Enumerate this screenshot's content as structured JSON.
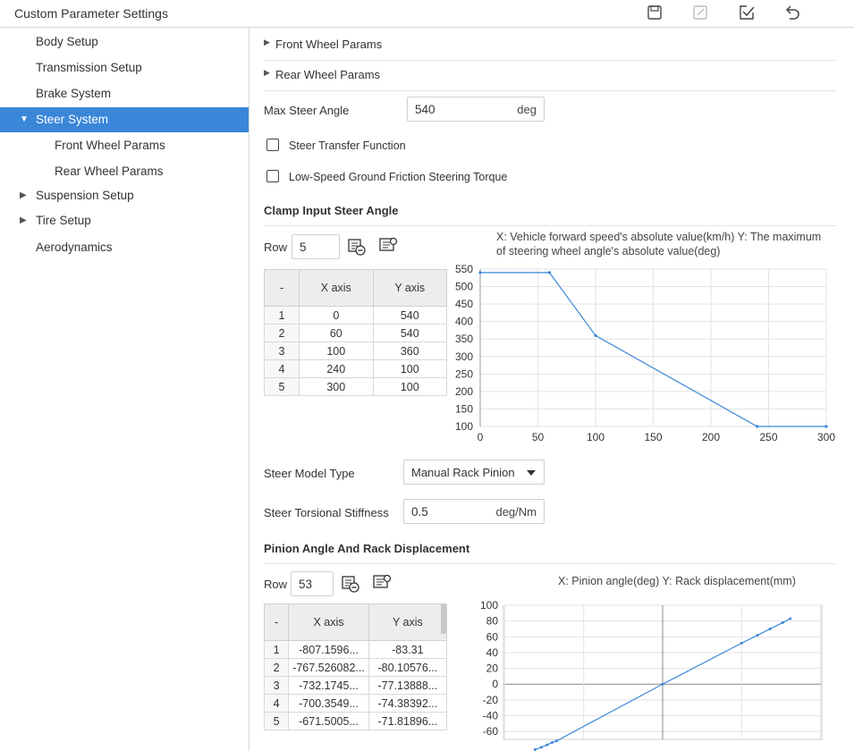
{
  "window": {
    "title": "Custom Parameter Settings",
    "toolbar": [
      {
        "name": "save-icon"
      },
      {
        "name": "edit-icon"
      },
      {
        "name": "confirm-icon"
      },
      {
        "name": "undo-icon"
      }
    ]
  },
  "sidebar": {
    "items": [
      {
        "label": "Body Setup",
        "level": 0,
        "arrow": "",
        "active": false
      },
      {
        "label": "Transmission Setup",
        "level": 0,
        "arrow": "",
        "active": false
      },
      {
        "label": "Brake System",
        "level": 0,
        "arrow": "",
        "active": false
      },
      {
        "label": "Steer System",
        "level": 0,
        "arrow": "▼",
        "active": true
      },
      {
        "label": "Front Wheel Params",
        "level": 1,
        "arrow": "",
        "active": false
      },
      {
        "label": "Rear Wheel Params",
        "level": 1,
        "arrow": "",
        "active": false
      },
      {
        "label": "Suspension Setup",
        "level": 0,
        "arrow": "▶",
        "active": false
      },
      {
        "label": "Tire Setup",
        "level": 0,
        "arrow": "▶",
        "active": false
      },
      {
        "label": "Aerodynamics",
        "level": 0,
        "arrow": "",
        "active": false
      }
    ]
  },
  "main": {
    "front_wheel_params": "Front Wheel Params",
    "rear_wheel_params": "Rear Wheel Params",
    "max_steer_angle": {
      "label": "Max Steer Angle",
      "value": "540",
      "unit": "deg"
    },
    "steer_transfer_function": {
      "label": "Steer Transfer Function",
      "checked": false
    },
    "low_speed_torque": {
      "label": "Low-Speed Ground Friction Steering Torque",
      "checked": false
    },
    "clamp": {
      "title": "Clamp Input Steer Angle",
      "row_label": "Row",
      "row_value": "5",
      "table": {
        "headers": [
          "-",
          "X axis",
          "Y axis"
        ],
        "rows": [
          [
            "1",
            "0",
            "540"
          ],
          [
            "2",
            "60",
            "540"
          ],
          [
            "3",
            "100",
            "360"
          ],
          [
            "4",
            "240",
            "100"
          ],
          [
            "5",
            "300",
            "100"
          ]
        ]
      },
      "caption": "X: Vehicle forward speed's absolute value(km/h) Y: The maximum of steering wheel angle's absolute value(deg)"
    },
    "steer_model_type": {
      "label": "Steer Model Type",
      "value": "Manual Rack Pinion"
    },
    "steer_torsional_stiffness": {
      "label": "Steer Torsional Stiffness",
      "value": "0.5",
      "unit": "deg/Nm"
    },
    "pinion": {
      "title": "Pinion Angle And Rack Displacement",
      "row_label": "Row",
      "row_value": "53",
      "table": {
        "headers": [
          "-",
          "X axis",
          "Y axis"
        ],
        "rows": [
          [
            "1",
            "-807.1596...",
            "-83.31"
          ],
          [
            "2",
            "-767.526082...",
            "-80.10576..."
          ],
          [
            "3",
            "-732.1745...",
            "-77.13888..."
          ],
          [
            "4",
            "-700.3549...",
            "-74.38392..."
          ],
          [
            "5",
            "-671.5005...",
            "-71.81896..."
          ]
        ]
      },
      "caption": "X: Pinion angle(deg) Y: Rack displacement(mm)"
    }
  },
  "chart_data": [
    {
      "type": "line",
      "title": "",
      "x": [
        0,
        60,
        100,
        240,
        300
      ],
      "series": [
        {
          "values": [
            540,
            540,
            360,
            100,
            100
          ]
        }
      ],
      "xlim": [
        0,
        300
      ],
      "ylim": [
        100,
        550
      ],
      "xticks": [
        0,
        50,
        100,
        150,
        200,
        250,
        300
      ],
      "yticks": [
        100,
        150,
        200,
        250,
        300,
        350,
        400,
        450,
        500,
        550
      ],
      "grid": true,
      "color": "#3a86d9"
    },
    {
      "type": "line",
      "title": "",
      "x": [
        -808,
        -768,
        -732,
        -700,
        -672,
        0,
        500,
        600,
        680,
        760,
        808
      ],
      "series": [
        {
          "values": [
            -83,
            -80,
            -77,
            -74,
            -72,
            0,
            52,
            62,
            70,
            78,
            83
          ]
        }
      ],
      "xlim": [
        -1008,
        1008
      ],
      "ylim": [
        -70,
        100
      ],
      "yticks": [
        -60,
        -40,
        -20,
        0,
        20,
        40,
        60,
        80,
        100
      ],
      "grid": true,
      "color": "#3a86d9"
    }
  ]
}
